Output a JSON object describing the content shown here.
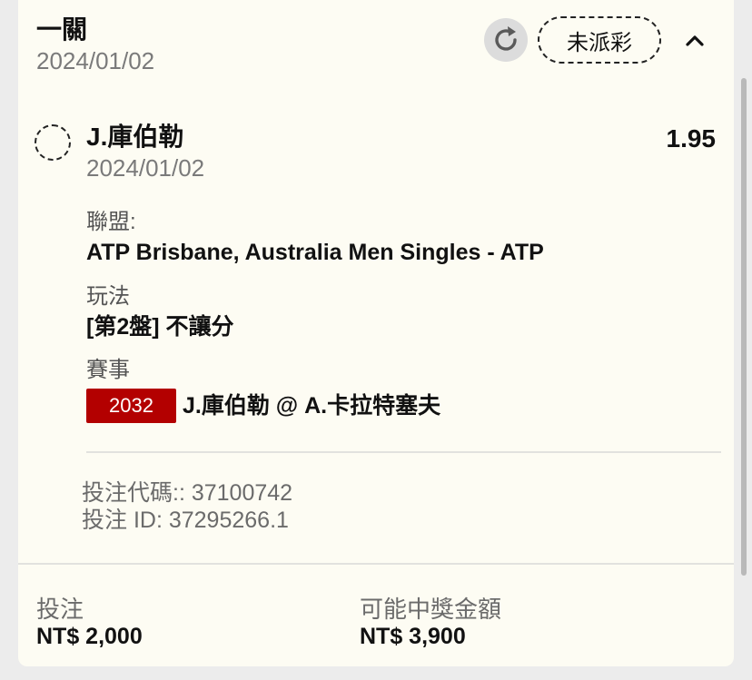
{
  "header": {
    "title": "一關",
    "date": "2024/01/02",
    "status": "未派彩"
  },
  "selection": {
    "name": "J.庫伯勒",
    "odds": "1.95",
    "date": "2024/01/02"
  },
  "details": {
    "league_label": "聯盟:",
    "league_value": "ATP Brisbane, Australia Men Singles - ATP",
    "market_label": "玩法",
    "market_value": "[第2盤] 不讓分",
    "event_label": "賽事",
    "event_id": "2032",
    "event_name": "J.庫伯勒 @ A.卡拉特塞夫"
  },
  "codes": {
    "bet_code": "投注代碼:: 37100742",
    "bet_id": "投注 ID: 37295266.1"
  },
  "footer": {
    "stake_label": "投注",
    "stake_value": "NT$ 2,000",
    "payout_label": "可能中獎金額",
    "payout_value": "NT$ 3,900"
  },
  "icons": {
    "refresh": "refresh-icon",
    "collapse": "chevron-up-icon"
  },
  "colors": {
    "card_bg": "#fdfcf3",
    "event_badge": "#b30000"
  }
}
